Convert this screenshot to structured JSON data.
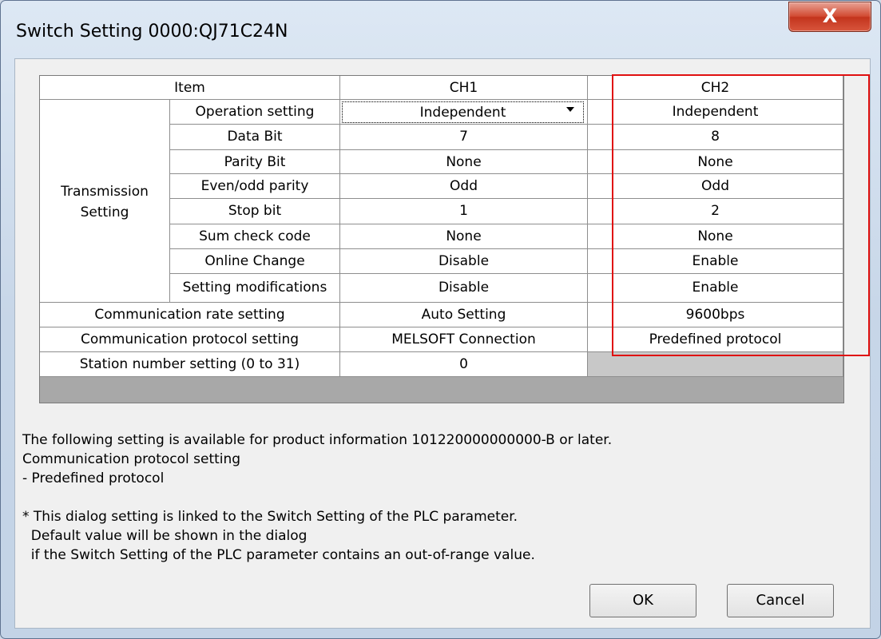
{
  "window": {
    "title": "Switch Setting 0000:QJ71C24N",
    "close_glyph": "X"
  },
  "table": {
    "headers": {
      "item": "Item",
      "ch1": "CH1",
      "ch2": "CH2"
    },
    "group_label": "Transmission Setting",
    "sub_rows": [
      {
        "label": "Operation setting",
        "ch1": "Independent",
        "ch2": "Independent"
      },
      {
        "label": "Data Bit",
        "ch1": "7",
        "ch2": "8"
      },
      {
        "label": "Parity Bit",
        "ch1": "None",
        "ch2": "None"
      },
      {
        "label": "Even/odd parity",
        "ch1": "Odd",
        "ch2": "Odd"
      },
      {
        "label": "Stop bit",
        "ch1": "1",
        "ch2": "2"
      },
      {
        "label": "Sum check code",
        "ch1": "None",
        "ch2": "None"
      },
      {
        "label": "Online Change",
        "ch1": "Disable",
        "ch2": "Enable"
      },
      {
        "label": "Setting modifications",
        "ch1": "Disable",
        "ch2": "Enable"
      }
    ],
    "rows": [
      {
        "label": "Communication rate setting",
        "ch1": "Auto Setting",
        "ch2": "9600bps"
      },
      {
        "label": "Communication protocol setting",
        "ch1": "MELSOFT Connection",
        "ch2": "Predefined protocol"
      },
      {
        "label": "Station number setting (0 to 31)",
        "ch1": "0",
        "ch2": ""
      }
    ]
  },
  "notes": {
    "line1": "The following setting is available for product information 101220000000000-B or later.",
    "line2": "Communication protocol setting",
    "line3": "- Predefined protocol",
    "line4": "* This dialog setting is linked to the Switch Setting of the PLC parameter.",
    "line5": "  Default value will be shown in the dialog",
    "line6": "  if the Switch Setting of the PLC parameter contains an out-of-range value."
  },
  "buttons": {
    "ok": "OK",
    "cancel": "Cancel"
  },
  "colors": {
    "highlight": "#e01010",
    "title_bar": "#c7d6e8",
    "close_button": "#d24b33"
  }
}
